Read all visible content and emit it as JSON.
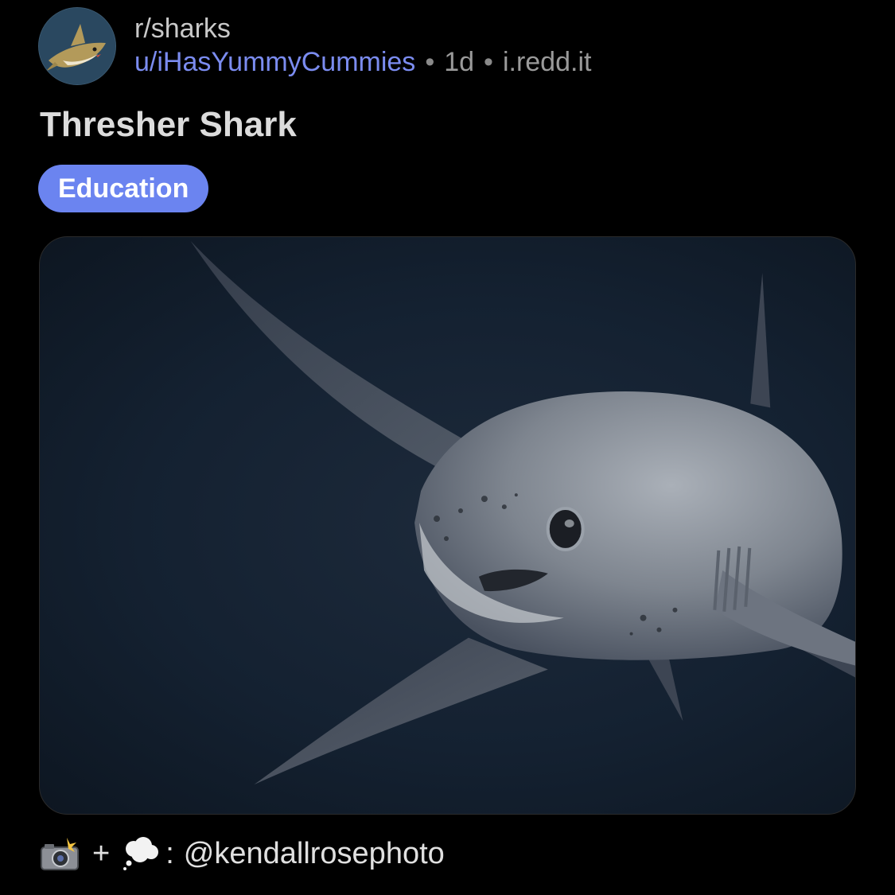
{
  "post": {
    "subreddit": "r/sharks",
    "author": "u/iHasYummyCummies",
    "separator": "•",
    "age": "1d",
    "domain": "i.redd.it",
    "title": "Thresher Shark",
    "flair": "Education",
    "avatar_icon": "shark-subreddit-avatar",
    "image_icon": "thresher-shark-photo",
    "caption": {
      "camera_icon": "camera-flash-emoji-icon",
      "plus": "+",
      "thought_icon": "thought-balloon-emoji-icon",
      "colon": ":",
      "handle": "@kendallrosephoto"
    }
  },
  "colors": {
    "background": "#000000",
    "author_link": "#7b8cf0",
    "flair_bg": "#6b84f0",
    "muted_text": "#9a9a9a"
  }
}
